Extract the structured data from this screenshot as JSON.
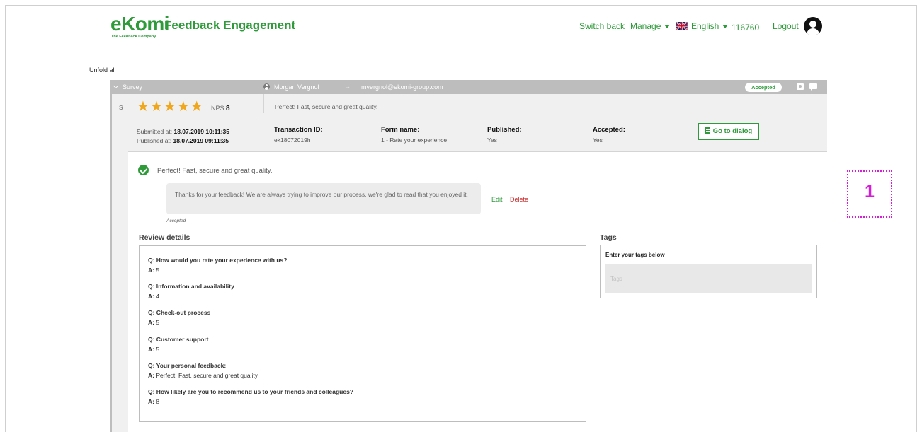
{
  "header": {
    "logo": "eKomi",
    "tagline": "The Feedback Company",
    "product_title": "Feedback Engagement",
    "nav": {
      "switch_back": "Switch back",
      "manage": "Manage",
      "language": "English",
      "account_id": "116760",
      "logout": "Logout"
    }
  },
  "unfold_all": "Unfold all",
  "survey_bar": {
    "label": "Survey",
    "customer_name": "Morgan Vergnol",
    "arrow": "→",
    "customer_email": "mvergnol@ekomi-group.com",
    "status_badge": "Accepted"
  },
  "review": {
    "rail_letter": "S",
    "rating_stars": 5,
    "star_glyph": "★",
    "nps_label": "NPS",
    "nps_value": "8",
    "comment": "Perfect! Fast, secure and great quality.",
    "submitted_label": "Submitted at:",
    "submitted_at": "18.07.2019 10:11:35",
    "published_label": "Published at:",
    "published_at": "18.07.2019 09:11:35",
    "meta": [
      {
        "key": "Transaction ID:",
        "value": "ek18072019h"
      },
      {
        "key": "Form name:",
        "value": "1 - Rate your experience"
      },
      {
        "key": "Published:",
        "value": "Yes"
      },
      {
        "key": "Accepted:",
        "value": "Yes"
      }
    ],
    "go_to_dialog": "Go to dialog"
  },
  "thread": {
    "comment": "Perfect! Fast, secure and great quality.",
    "reply": "Thanks for your feedback! We are always trying to improve our process, we're glad to read that you enjoyed it.",
    "reply_status": "Accepted",
    "edit": "Edit",
    "delete": "Delete"
  },
  "review_details": {
    "title": "Review details",
    "items": [
      {
        "q": "Q: How would you rate your experience with us?",
        "a_prefix": "A:",
        "a": "5"
      },
      {
        "q": "Q: Information and availability",
        "a_prefix": "A:",
        "a": "4"
      },
      {
        "q": "Q: Check-out process",
        "a_prefix": "A:",
        "a": "5"
      },
      {
        "q": "Q: Customer support",
        "a_prefix": "A:",
        "a": "5"
      },
      {
        "q": "Q: Your personal feedback:",
        "a_prefix": "A:",
        "a": "Perfect! Fast, secure and great quality."
      },
      {
        "q": "Q: How likely are you to recommend us to your friends and colleagues?",
        "a_prefix": "A:",
        "a": "8"
      }
    ]
  },
  "tags": {
    "title": "Tags",
    "instruction": "Enter your tags below",
    "placeholder": "Tags"
  },
  "annotation": {
    "label": "1"
  },
  "colors": {
    "brand_green": "#2e9a3a",
    "star": "#f0a71c",
    "delete_red": "#c62828",
    "annotation": "#d81bd8"
  },
  "icons": [
    "chevron-down-icon",
    "user-icon",
    "profile-icon",
    "chat-icon",
    "check-icon",
    "document-icon",
    "uk-flag-icon",
    "avatar-icon",
    "star-icon"
  ]
}
